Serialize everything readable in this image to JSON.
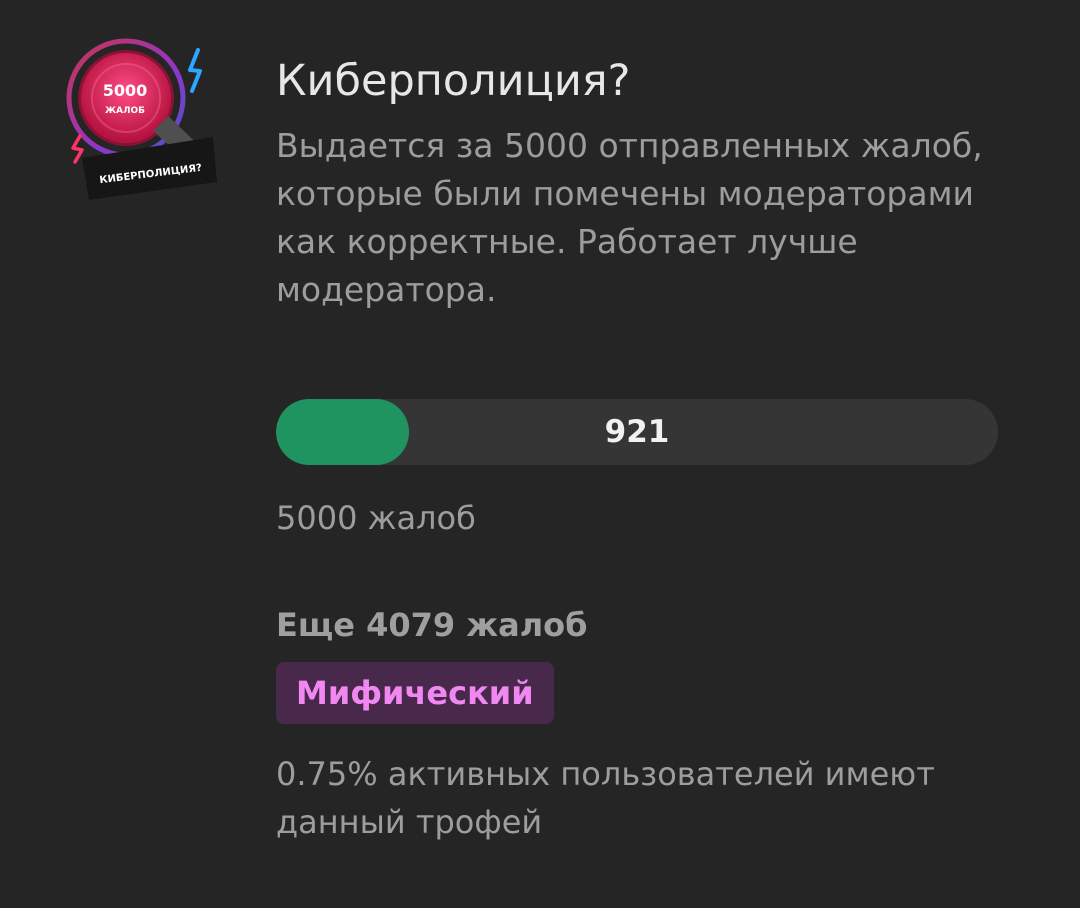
{
  "badge": {
    "count_text": "5000",
    "unit_text": "ЖАЛОБ",
    "ribbon_text": "КИБЕРПОЛИЦИЯ?",
    "colors": {
      "ring_start": "#ff3c59",
      "ring_end": "#7f4cff",
      "center": "#e9175a",
      "lightning": "#2aa7ff"
    }
  },
  "trophy": {
    "title": "Киберполиция?",
    "description": "Выдается за 5000 отправленных жалоб, которые были помечены модераторами как корректные. Работает лучше модератора."
  },
  "progress": {
    "current": 921,
    "target": 5000,
    "value_label": "921",
    "fill_color": "#1f9461"
  },
  "target_label": "5000 жалоб",
  "remaining_label": "Еще 4079 жалоб",
  "rarity": {
    "label": "Мифический",
    "text_color": "#f187f1",
    "background_color": "#49294b"
  },
  "stats_text": "0.75% активных пользователей имеют данный трофей"
}
